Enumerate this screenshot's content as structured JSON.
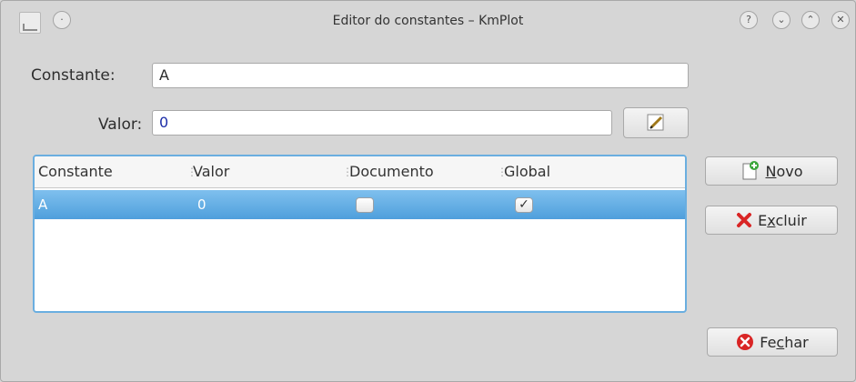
{
  "window": {
    "title": "Editor do constantes – KmPlot"
  },
  "form": {
    "constante_label": "Constante:",
    "constante_value": "A",
    "valor_label": "Valor:",
    "valor_value": "0"
  },
  "table": {
    "headers": [
      "Constante",
      "Valor",
      "Documento",
      "Global"
    ],
    "rows": [
      {
        "constante": "A",
        "valor": "0",
        "documento": false,
        "global": true
      }
    ]
  },
  "buttons": {
    "novo": {
      "pre": "",
      "mn": "N",
      "post": "ovo"
    },
    "excluir": {
      "pre": "E",
      "mn": "x",
      "post": "cluir"
    },
    "fechar": {
      "pre": "Fe",
      "mn": "c",
      "post": "har"
    }
  },
  "colors": {
    "selection": "#4f9fdc",
    "table_border": "#6aaee0",
    "valor_text": "#1d2ea8",
    "delete_icon": "#d92525",
    "close_icon": "#d92525"
  }
}
